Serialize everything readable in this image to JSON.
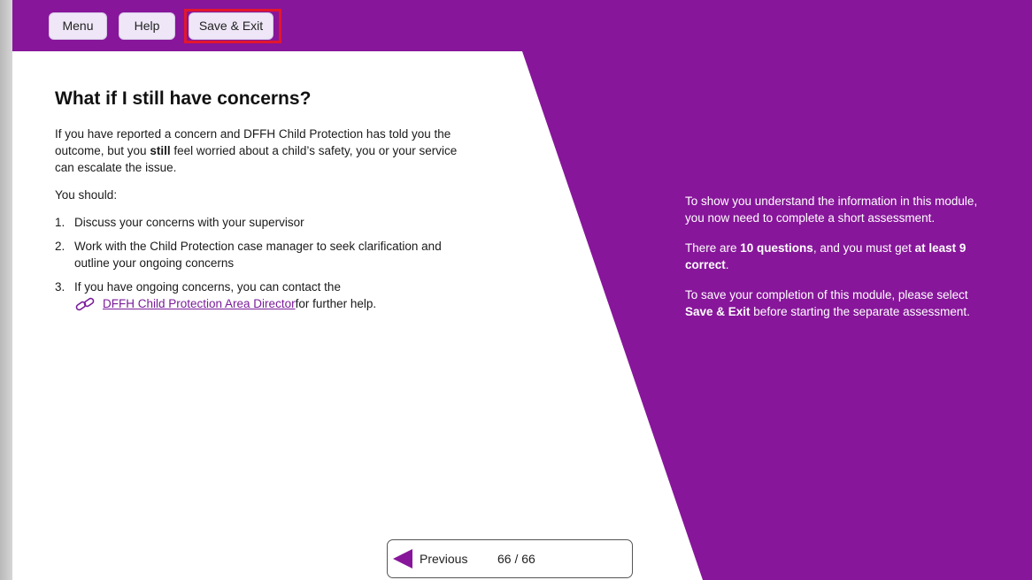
{
  "header": {
    "menu_label": "Menu",
    "help_label": "Help",
    "save_exit_label": "Save & Exit"
  },
  "main": {
    "title": "What if I still have concerns?",
    "intro_before": "If you have reported a concern and DFFH Child Protection has told you the outcome, but you ",
    "intro_bold": "still",
    "intro_after": " feel worried about a child’s safety, you or your service can escalate the issue.",
    "you_should": "You should:",
    "steps": [
      {
        "num": "1.",
        "text": "Discuss your concerns with your supervisor"
      },
      {
        "num": "2.",
        "text": "Work with the Child Protection case manager to seek clarification and outline your ongoing concerns"
      },
      {
        "num": "3.",
        "text": "If you have ongoing concerns, you can contact the"
      }
    ],
    "link_label": "DFFH Child Protection Area Director",
    "link_suffix": " for further help.",
    "link_icon": "link-icon"
  },
  "side_panel": {
    "para1": "To show you understand the information in this module, you now need to complete a short assessment.",
    "para2_before": "There are ",
    "para2_bold1": "10 questions",
    "para2_mid": ", and you must get ",
    "para2_bold2": "at least 9 correct",
    "para2_after": ".",
    "para3_before": "To save your completion of this module, please select ",
    "para3_bold": "Save & Exit",
    "para3_after": " before starting the separate assessment."
  },
  "pager": {
    "previous_label": "Previous",
    "page_count": "66 / 66"
  },
  "colors": {
    "brand_purple": "#87169a",
    "highlight_red": "#e3172d",
    "link_purple": "#7a1c9a"
  }
}
